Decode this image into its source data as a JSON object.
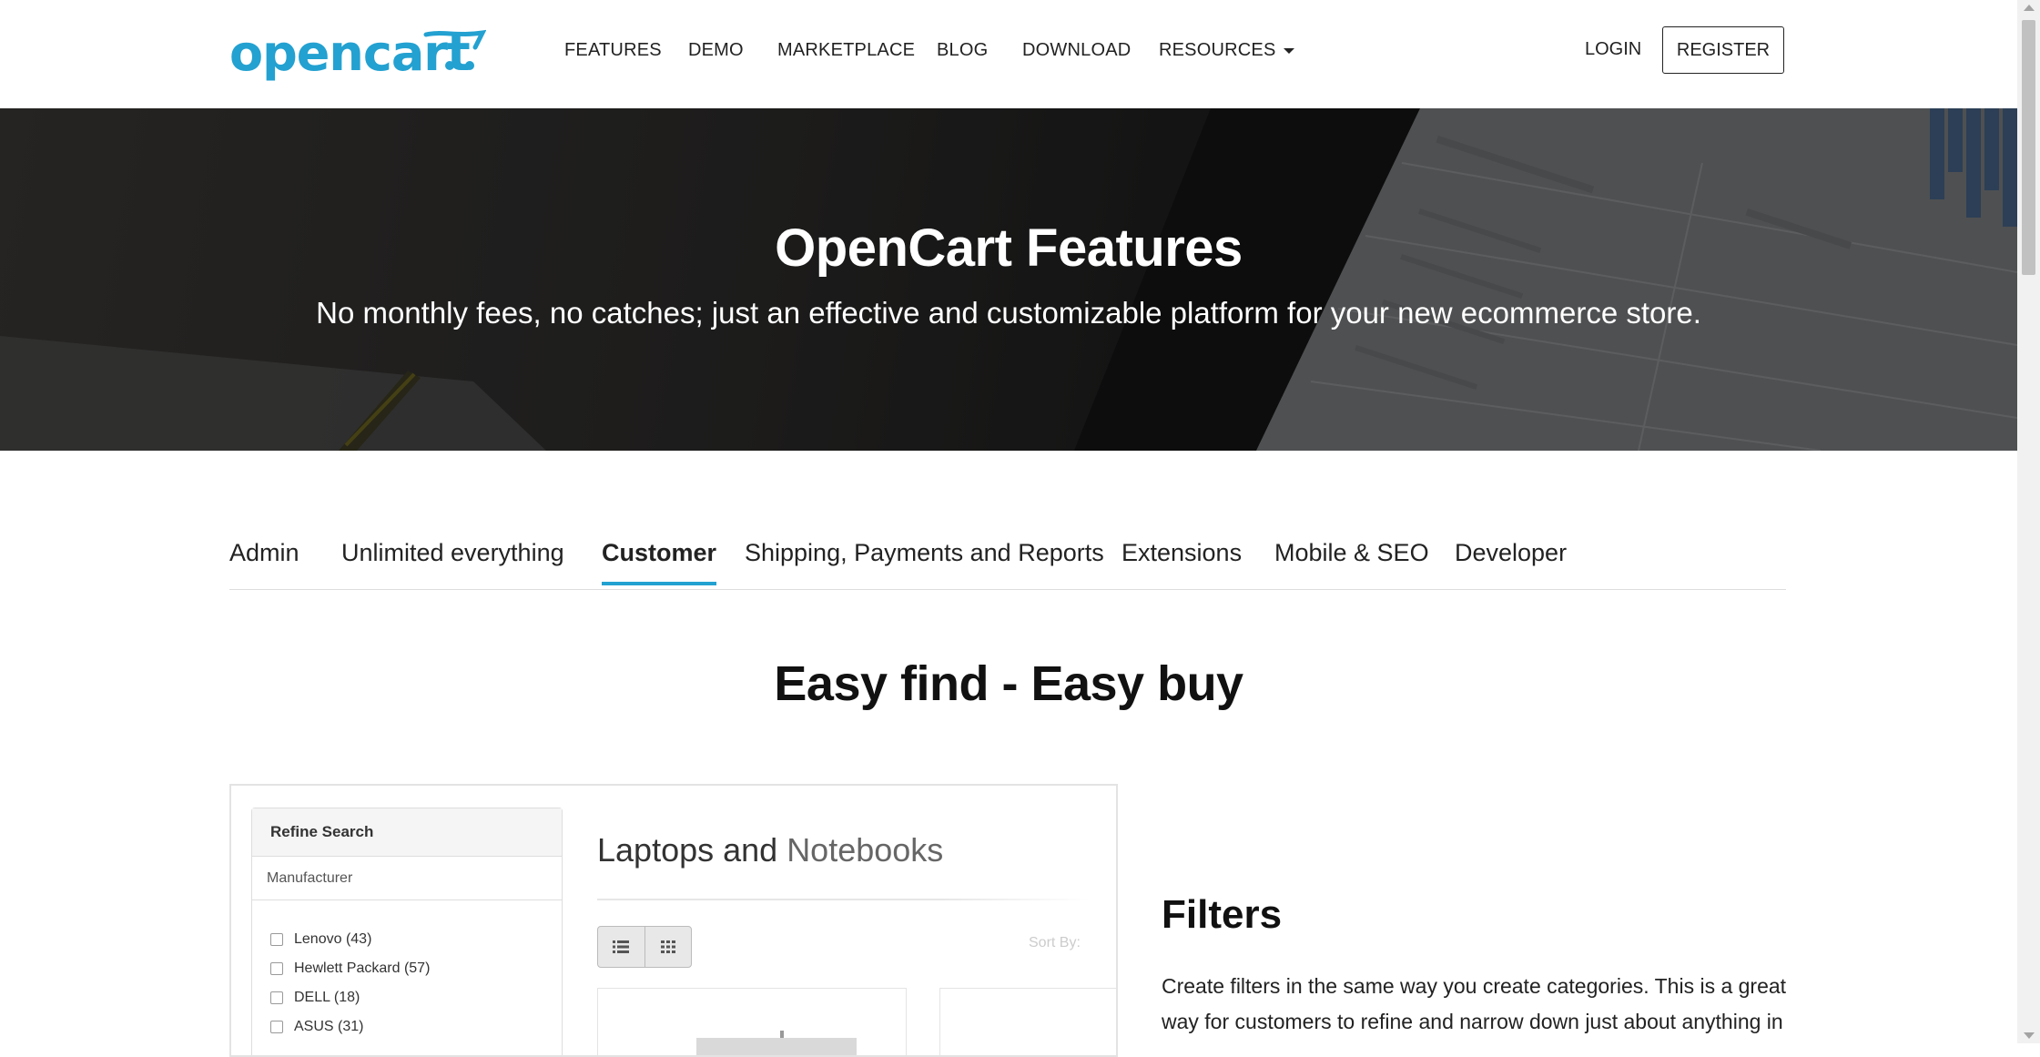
{
  "header": {
    "logo_text": "opencart",
    "nav": [
      {
        "label": "FEATURES"
      },
      {
        "label": "DEMO"
      },
      {
        "label": "MARKETPLACE"
      },
      {
        "label": "BLOG"
      },
      {
        "label": "DOWNLOAD"
      },
      {
        "label": "RESOURCES"
      }
    ],
    "login_label": "LOGIN",
    "register_label": "REGISTER"
  },
  "hero": {
    "title": "OpenCart Features",
    "subtitle": "No monthly fees, no catches; just an effective and customizable platform for your new ecommerce store."
  },
  "tabs": [
    {
      "label": "Admin",
      "active": false
    },
    {
      "label": "Unlimited everything",
      "active": false
    },
    {
      "label": "Customer",
      "active": true
    },
    {
      "label": "Shipping, Payments and Reports",
      "active": false
    },
    {
      "label": "Extensions",
      "active": false
    },
    {
      "label": "Mobile & SEO",
      "active": false
    },
    {
      "label": "Developer",
      "active": false
    }
  ],
  "section": {
    "title": "Easy find - Easy buy",
    "screenshot": {
      "refine_heading": "Refine Search",
      "refine_group": "Manufacturer",
      "manufacturers": [
        "Lenovo (43)",
        "Hewlett Packard (57)",
        "DELL (18)",
        "ASUS (31)"
      ],
      "category_title_a": "Laptops and ",
      "category_title_b": "Notebooks",
      "sort_label": "Sort By:"
    },
    "feature": {
      "title": "Filters",
      "text": "Create filters in the same way you create categories. This is a great way for customers to refine and narrow down just about anything in"
    }
  },
  "colors": {
    "brand": "#23a1d1",
    "tab_active_underline": "#23a1d1"
  }
}
